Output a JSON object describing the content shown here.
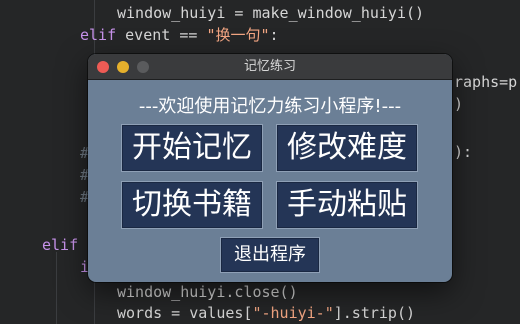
{
  "code": {
    "line1": "window_huiyi = make_window_huiyi()",
    "line2_kw": "elif",
    "line2_mid": " event == ",
    "line2_str": "\"换一句\"",
    "line2_end": ":",
    "right_frag1": "raphs=p",
    "right_frag2": ")",
    "right_frag3": "):",
    "hash1": "#",
    "hash2": "#",
    "hash3": "#",
    "elif_kw": "elif",
    "i_frag": "i",
    "line_close": "window_huiyi.close()",
    "line_words_pre": "words = values[",
    "line_words_str": "\"-huiyi-\"",
    "line_words_post": "].strip()"
  },
  "window": {
    "title": "记忆练习",
    "welcome": "---欢迎使用记忆力练习小程序!---",
    "buttons": {
      "start": "开始记忆",
      "difficulty": "修改难度",
      "switch_book": "切换书籍",
      "manual_paste": "手动粘贴",
      "exit": "退出程序"
    }
  }
}
